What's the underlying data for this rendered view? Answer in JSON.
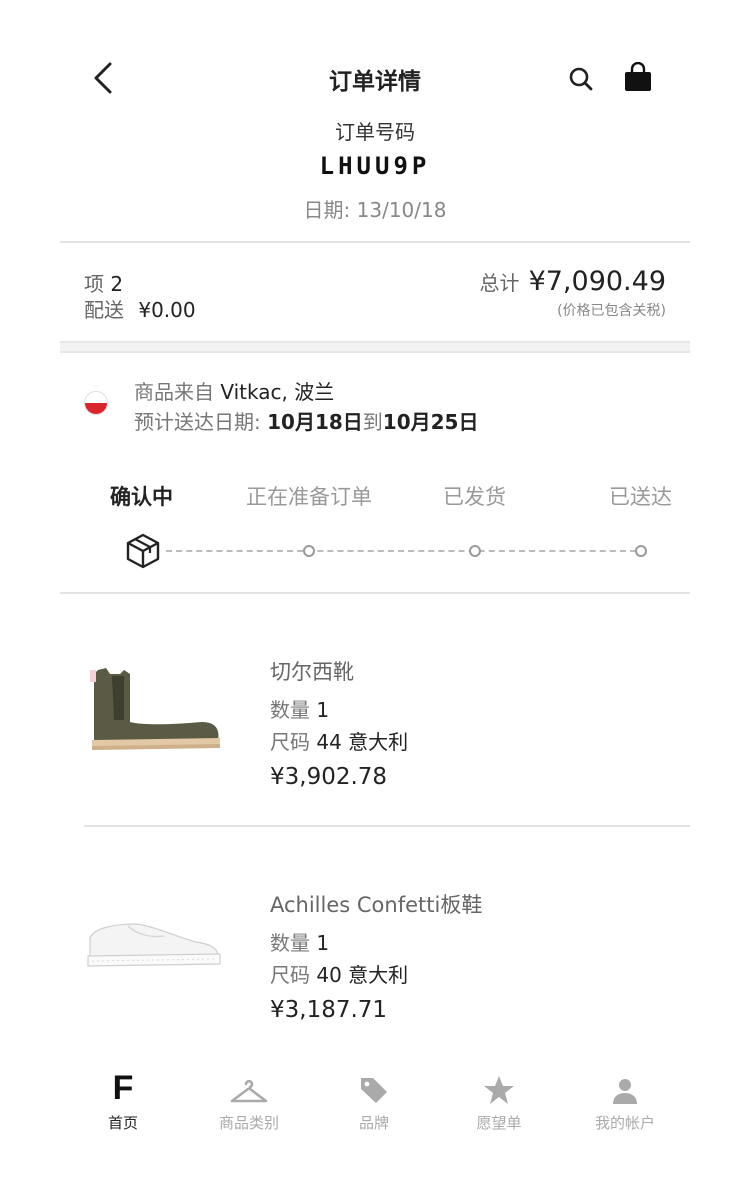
{
  "header": {
    "title": "订单详情"
  },
  "order": {
    "number_label": "订单号码",
    "number": "LHUU9P",
    "date": "日期: 13/10/18"
  },
  "summary": {
    "items_label": "项",
    "items_value": "2",
    "shipping_label": "配送",
    "shipping_value": "¥0.00",
    "total_label": "总计",
    "total_value": "¥7,090.49",
    "tax_note": "(价格已包含关税)"
  },
  "merchant": {
    "from_prefix": "商品来自",
    "from_value": "Vitkac, 波兰",
    "eta_label": "预计送达日期:",
    "eta_start": "10月18日",
    "eta_mid": "到",
    "eta_end": "10月25日"
  },
  "status": {
    "steps": [
      "确认中",
      "正在准备订单",
      "已发货",
      "已送达"
    ],
    "current_step": 1
  },
  "products": [
    {
      "name": "切尔西靴",
      "qty_label": "数量",
      "qty": "1",
      "size_label": "尺码",
      "size": "44 意大利",
      "price": "¥3,902.78"
    },
    {
      "name": "Achilles Confetti板鞋",
      "qty_label": "数量",
      "qty": "1",
      "size_label": "尺码",
      "size": "40 意大利",
      "price": "¥3,187.71"
    }
  ],
  "tabbar": {
    "items": [
      {
        "label": "首页",
        "icon": "farfetch-logo-icon"
      },
      {
        "label": "商品类别",
        "icon": "hanger-icon"
      },
      {
        "label": "品牌",
        "icon": "tag-icon"
      },
      {
        "label": "愿望单",
        "icon": "star-icon"
      },
      {
        "label": "我的帐户",
        "icon": "user-icon"
      }
    ],
    "active_index": 0
  },
  "colors": {
    "flag_red": "#d9242b",
    "text_dark": "#222222",
    "text_muted": "#888888"
  }
}
